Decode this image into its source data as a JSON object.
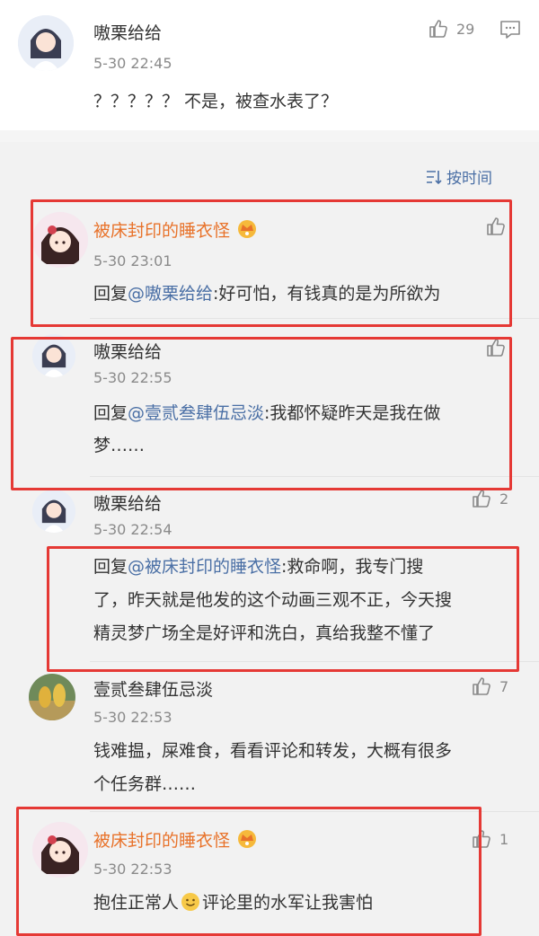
{
  "top_comment": {
    "user": "嗷栗给给",
    "time": "5-30 22:45",
    "text": "？？？？？ 不是，被查水表了？",
    "likes": "29"
  },
  "sort_label": "按时间",
  "replies": [
    {
      "user": "被床封印的睡衣怪",
      "time": "5-30 23:01",
      "prefix": "回复",
      "mention": "@嗷栗给给",
      "text": ":好可怕，有钱真的是为所欲为",
      "likes": ""
    },
    {
      "user": "嗷栗给给",
      "time": "5-30 22:55",
      "prefix": "回复",
      "mention": "@壹贰叁肆伍忌淡",
      "text_line1": ":我都怀疑昨天是我在做",
      "text_line2": "梦……",
      "likes": ""
    },
    {
      "user": "嗷栗给给",
      "time": "5-30 22:54",
      "prefix": "回复",
      "mention": "@被床封印的睡衣怪",
      "text_line1": ":救命啊，我专门搜",
      "text_line2": "了，昨天就是他发的这个动画三观不正，今天搜",
      "text_line3": "精灵梦广场全是好评和洗白，真给我整不懂了",
      "likes": "2"
    },
    {
      "user": "壹贰叁肆伍忌淡",
      "time": "5-30 22:53",
      "text_line1": "钱难揾，屎难食，看看评论和转发，大概有很多",
      "text_line2": "个任务群……",
      "likes": "7"
    },
    {
      "user": "被床封印的睡衣怪",
      "time": "5-30 22:53",
      "text_a": "抱住正常人",
      "text_b": "评论里的水军让我害怕",
      "likes": "1"
    }
  ],
  "colors": {
    "vip_name": "#e8722a",
    "mention": "#4a6fa5",
    "highlight_box": "#e53935"
  },
  "icons": [
    "thumbs-up-icon",
    "comment-icon",
    "sort-icon",
    "vip-crown-icon",
    "smile-emoji-icon"
  ]
}
